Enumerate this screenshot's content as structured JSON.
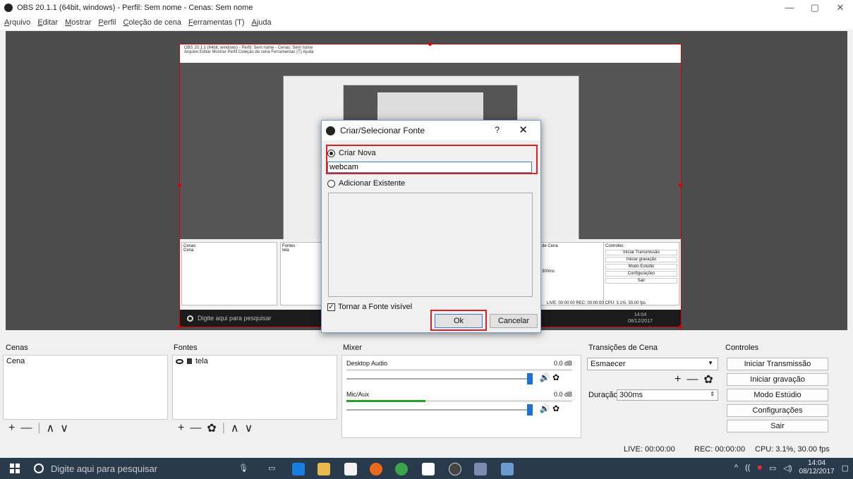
{
  "window": {
    "title": "OBS 20.1.1 (64bit, windows) - Perfil: Sem nome - Cenas: Sem nome",
    "minimize": "—",
    "maximize": "▢",
    "close": "✕"
  },
  "menu": [
    "Arquivo",
    "Editar",
    "Mostrar",
    "Perfil",
    "Coleção de cena",
    "Ferramentas (T)",
    "Ajuda"
  ],
  "preview": {
    "capture_title": "OBS 20.1.1 (64bit, windows) - Perfil: Sem nome - Cenas: Sem nome",
    "capture_menu": "Arquivo  Editar  Mostrar  Perfil  Coleção de cena  Ferramentas (T)  Ajuda",
    "capture_nested_dialog": "Criar/Selecionar Fonte",
    "capture_docks": {
      "cenas": "Cenas",
      "cena": "Cena",
      "fontes": "Fontes",
      "tela": "tela",
      "transicoes": "de Cena",
      "controles": "Controles",
      "controls": [
        "Iniciar Transmissão",
        "Iniciar gravação",
        "Modo Estúdio",
        "Configurações",
        "Sair"
      ],
      "duration": "300ms",
      "status": "LIVE: 00:00:00   REC: 00:00:00   CPU: 3.1%, 30.00 fps"
    },
    "capture_taskbar_search": "Digite aqui para pesquisar",
    "capture_time": "14:04",
    "capture_date": "08/12/2017"
  },
  "dialog": {
    "title": "Criar/Selecionar Fonte",
    "help": "?",
    "close": "✕",
    "create_new_label": "Criar Nova",
    "name_value": "webcam",
    "add_existing_label": "Adicionar Existente",
    "visible_label": "Tornar a Fonte visível",
    "ok_label": "Ok",
    "cancel_label": "Cancelar"
  },
  "docks": {
    "scenes": {
      "header": "Cenas",
      "items": [
        "Cena"
      ]
    },
    "sources": {
      "header": "Fontes",
      "items": [
        "tela"
      ]
    },
    "mixer": {
      "header": "Mixer",
      "channels": [
        {
          "name": "Desktop Audio",
          "db": "0.0 dB",
          "level": 0
        },
        {
          "name": "Mic/Aux",
          "db": "0.0 dB",
          "level": 0.35
        }
      ]
    },
    "transitions": {
      "header": "Transições de Cena",
      "selected": "Esmaecer",
      "duration_label": "Duração",
      "duration_value": "300ms"
    },
    "controls": {
      "header": "Controles",
      "buttons": [
        "Iniciar Transmissão",
        "Iniciar gravação",
        "Modo Estúdio",
        "Configurações",
        "Sair"
      ]
    }
  },
  "status": {
    "live": "LIVE: 00:00:00",
    "rec": "REC: 00:00:00",
    "cpu": "CPU: 3.1%, 30.00 fps"
  },
  "taskbar": {
    "search_placeholder": "Digite aqui para pesquisar",
    "time": "14:04",
    "date": "08/12/2017"
  },
  "colors": {
    "highlight": "#dd2222",
    "taskbar": "#2a3a4d",
    "preview_bg": "#4c4c4c"
  }
}
